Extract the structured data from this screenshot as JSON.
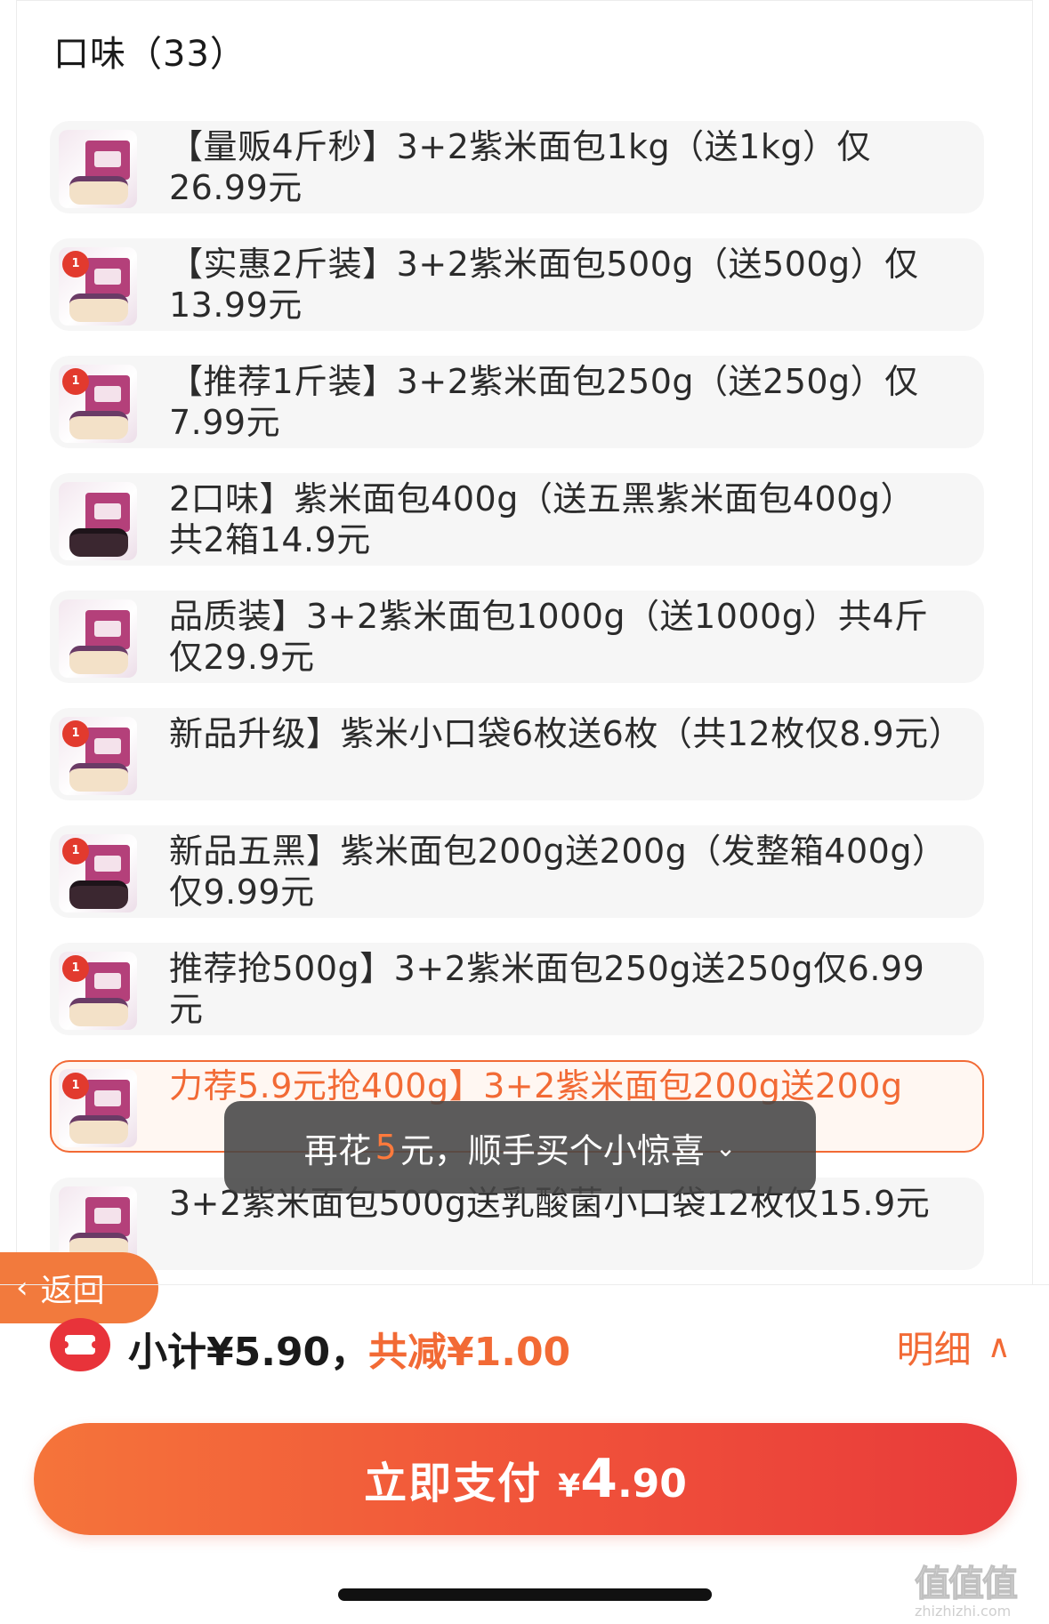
{
  "section": {
    "title": "口味（33）"
  },
  "options": [
    {
      "label": "【量贩4斤秒】3+2紫米面包1kg（送1kg）仅26.99元",
      "badge": "",
      "selected": false
    },
    {
      "label": "【实惠2斤装】3+2紫米面包500g（送500g）仅13.99元",
      "badge": "1",
      "selected": false
    },
    {
      "label": "【推荐1斤装】3+2紫米面包250g（送250g）仅7.99元",
      "badge": "1",
      "selected": false
    },
    {
      "label": "2口味】紫米面包400g（送五黑紫米面包400g）共2箱14.9元",
      "badge": "",
      "selected": false
    },
    {
      "label": "品质装】3+2紫米面包1000g（送1000g）共4斤仅29.9元",
      "badge": "",
      "selected": false
    },
    {
      "label": "新品升级】紫米小口袋6枚送6枚（共12枚仅8.9元）",
      "badge": "1",
      "selected": false
    },
    {
      "label": "新品五黑】紫米面包200g送200g（发整箱400g）仅9.99元",
      "badge": "1",
      "selected": false
    },
    {
      "label": "推荐抢500g】3+2紫米面包250g送250g仅6.99元",
      "badge": "1",
      "selected": false
    },
    {
      "label": "力荐5.9元抢400g】3+2紫米面包200g送200g",
      "badge": "1",
      "selected": true
    },
    {
      "label": "3+2紫米面包500g送乳酸菌小口袋12枚仅15.9元",
      "badge": "",
      "selected": false
    }
  ],
  "toast": {
    "prefix": "再花",
    "amount": "5",
    "suffix": "元，顺手买个小惊喜"
  },
  "back": {
    "label": "返回"
  },
  "summary": {
    "subtotal": "小计¥5.90，",
    "discount": "共减¥1.00",
    "detail": "明细"
  },
  "pay": {
    "label": "立即支付",
    "currency": "¥",
    "integer": "4",
    "decimal": ".90"
  },
  "watermark": {
    "glyphs": "值值值",
    "url": "zhizhizhi.com"
  },
  "colors": {
    "accent": "#f26a35",
    "danger": "#e8333a",
    "toast_bg": "#464646"
  }
}
